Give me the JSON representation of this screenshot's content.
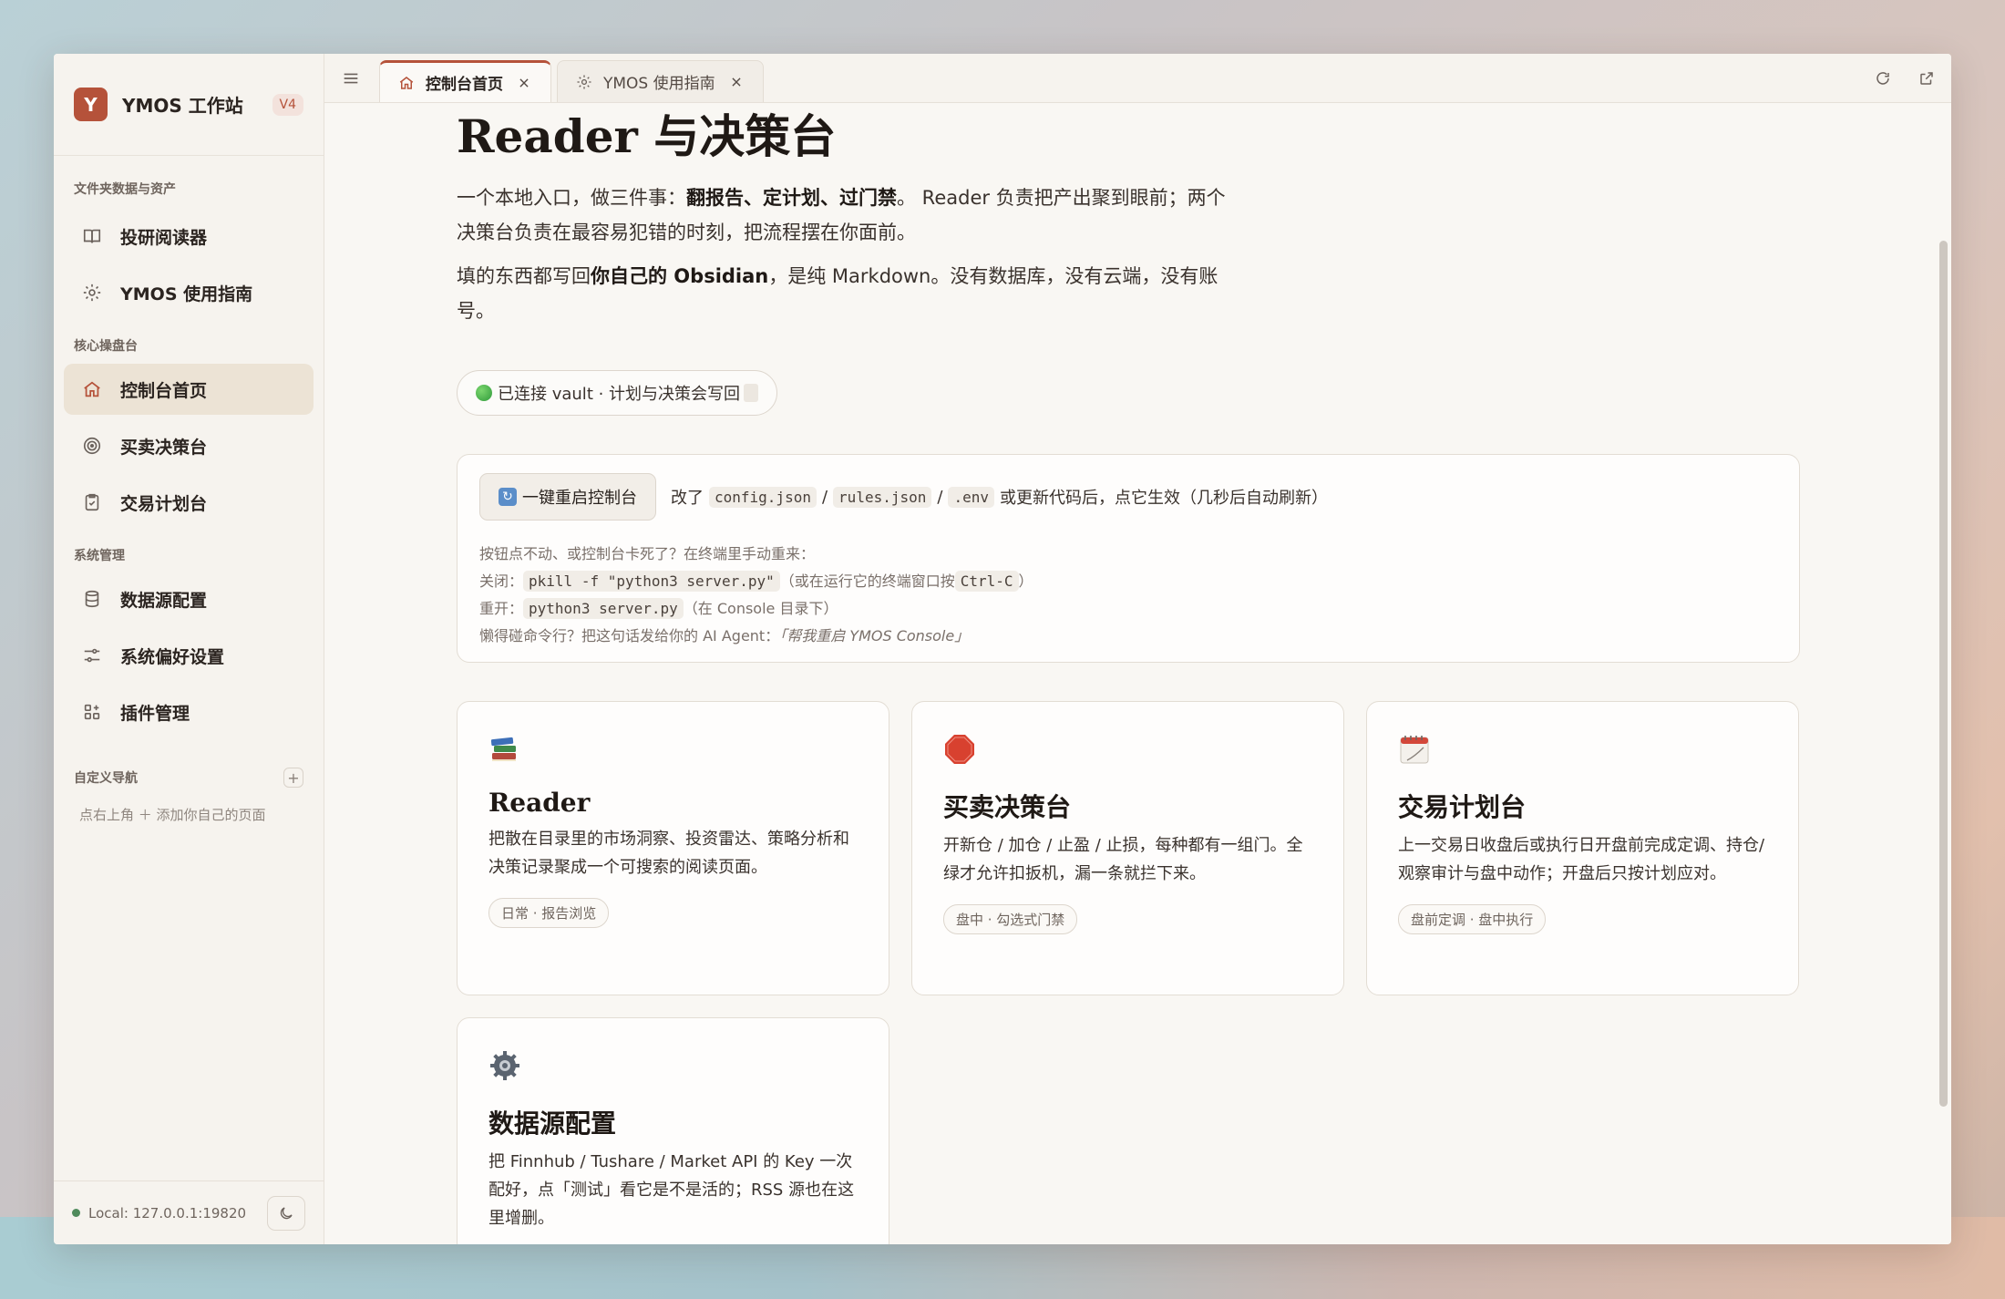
{
  "brand": {
    "logo_letter": "Y",
    "name": "YMOS 工作站",
    "version": "V4",
    "accent": "#b5523a"
  },
  "sidebar": {
    "sections": [
      {
        "label": "文件夹数据与资产",
        "items": [
          {
            "label": "投研阅读器",
            "icon": "book-icon"
          },
          {
            "label": "YMOS 使用指南",
            "icon": "gear-icon"
          }
        ]
      },
      {
        "label": "核心操盘台",
        "items": [
          {
            "label": "控制台首页",
            "icon": "home-icon",
            "active": true
          },
          {
            "label": "买卖决策台",
            "icon": "target-icon"
          },
          {
            "label": "交易计划台",
            "icon": "clipboard-icon"
          }
        ]
      },
      {
        "label": "系统管理",
        "items": [
          {
            "label": "数据源配置",
            "icon": "database-icon"
          },
          {
            "label": "系统偏好设置",
            "icon": "sliders-icon"
          },
          {
            "label": "插件管理",
            "icon": "apps-icon"
          }
        ]
      }
    ],
    "custom_nav": {
      "label": "自定义导航",
      "hint": "点右上角 ＋ 添加你自己的页面"
    },
    "footer": {
      "local": "Local: 127.0.0.1:19820"
    }
  },
  "tabs": [
    {
      "label": "控制台首页",
      "icon": "home-icon",
      "active": true
    },
    {
      "label": "YMOS 使用指南",
      "icon": "gear-icon",
      "active": false
    }
  ],
  "page": {
    "title": "Reader 与决策台",
    "intro1_a": "一个本地入口，做三件事：",
    "intro1_b": "翻报告、定计划、过门禁",
    "intro1_c": "。 Reader 负责把产出聚到眼前；两个决策台负责在最容易犯错的时刻，把流程摆在你面前。",
    "intro2_a": "填的东西都写回",
    "intro2_b": "你自己的 Obsidian",
    "intro2_c": "，是纯 Markdown。没有数据库，没有云端，没有账号。",
    "status_pill": "已连接 vault · 计划与决策会写回"
  },
  "restart": {
    "button": "一键重启控制台",
    "desc_prefix": "改了",
    "file1": "config.json",
    "sep": "/",
    "file2": "rules.json",
    "file3": ".env",
    "desc_suffix": "或更新代码后，点它生效（几秒后自动刷新）",
    "manual_title": "按钮点不动、或控制台卡死了？在终端里手动重来：",
    "close_label": "关闭：",
    "close_cmd": "pkill -f \"python3 server.py\"",
    "close_note": "（或在运行它的终端窗口按",
    "close_key": "Ctrl-C",
    "close_end": "）",
    "reopen_label": "重开：",
    "reopen_cmd": "python3 server.py",
    "reopen_note": "（在 Console 目录下）",
    "lazy": "懒得碰命令行？把这句话发给你的 AI Agent：",
    "lazy_quote": "「帮我重启 YMOS Console」"
  },
  "cards": [
    {
      "icon": "books-emoji",
      "title": "Reader",
      "desc": "把散在目录里的市场洞察、投资雷达、策略分析和决策记录聚成一个可搜索的阅读页面。",
      "tag": "日常 · 报告浏览"
    },
    {
      "icon": "stop-sign-emoji",
      "title": "买卖决策台",
      "desc": "开新仓 / 加仓 / 止盈 / 止损，每种都有一组门。全绿才允许扣扳机，漏一条就拦下来。",
      "tag": "盘中 · 勾选式门禁"
    },
    {
      "icon": "calendar-emoji",
      "title": "交易计划台",
      "desc": "上一交易日收盘后或执行日开盘前完成定调、持仓/观察审计与盘中动作；开盘后只按计划应对。",
      "tag": "盘前定调 · 盘中执行"
    },
    {
      "icon": "gear-emoji",
      "title": "数据源配置",
      "desc": "把 Finnhub / Tushare / Market API 的 Key 一次配好，点「测试」看它是不是活的；RSS 源也在这里增删。",
      "tag": ""
    }
  ]
}
